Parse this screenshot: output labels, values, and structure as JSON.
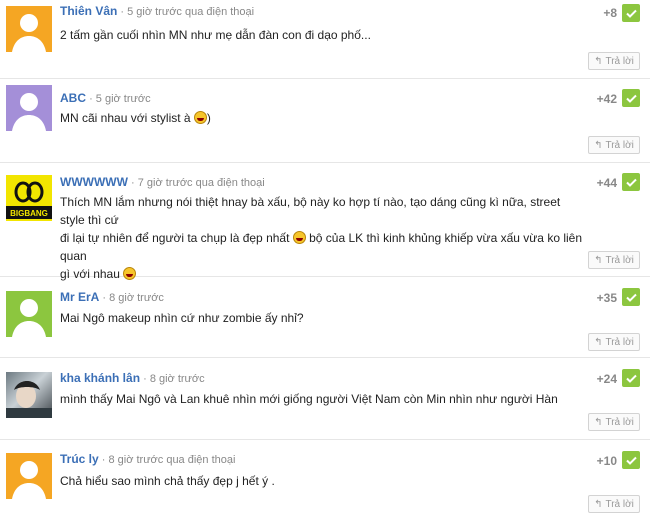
{
  "comments": [
    {
      "author": "Thiên Vân",
      "meta": "· 5 giờ trước qua điện thoại",
      "score": "+8",
      "body": "2 tấm gần cuối nhìn MN như mẹ dẫn đàn con đi dạo phố...",
      "avatar": "avatar-orange-icon"
    },
    {
      "author": "ABC",
      "meta": "· 5 giờ trước",
      "score": "+42",
      "body_before": "MN cãi nhau với stylist à ",
      "body_after": ")",
      "avatar": "avatar-purple-icon"
    },
    {
      "author": "WWWWWW",
      "meta": "· 7 giờ trước qua điện thoại",
      "score": "+44",
      "body_l1": "Thích MN lắm nhưng nói thiệt hnay bà xấu, bộ này ko hợp tí nào, tạo dáng cũng kì nữa, street style thì cứ",
      "body_l2a": "đi lại tự nhiên để người ta chụp là đẹp nhất ",
      "body_l2b": " bộ của LK thì kinh khủng khiếp vừa xấu vừa ko liên quan",
      "body_l3": "gì với nhau ",
      "avatar": "bigbang-logo-icon",
      "logo_text": "BIGBANG"
    },
    {
      "author": "Mr ErA",
      "meta": "· 8 giờ trước",
      "score": "+35",
      "body": "Mai Ngô makeup nhìn cứ như zombie ấy nhỉ?",
      "avatar": "avatar-green-icon"
    },
    {
      "author": "kha khánh lân",
      "meta": "· 8 giờ trước",
      "score": "+24",
      "body": "mình thấy Mai Ngô và Lan khuê nhìn mới giống người Việt Nam còn Min nhìn như người Hàn",
      "avatar": "user-photo-icon"
    },
    {
      "author": "Trúc ly",
      "meta": "· 8 giờ trước qua điện thoại",
      "score": "+10",
      "body": "Chả hiểu sao mình chả thấy đẹp j hết ý .",
      "avatar": "avatar-orange-icon"
    }
  ],
  "reply_label": "Trả lời",
  "colors": {
    "orange": "#f5a623",
    "purple": "#a48fd8",
    "green": "#8cc63f",
    "like": "#8cc63f",
    "author": "#3b6fb6"
  }
}
